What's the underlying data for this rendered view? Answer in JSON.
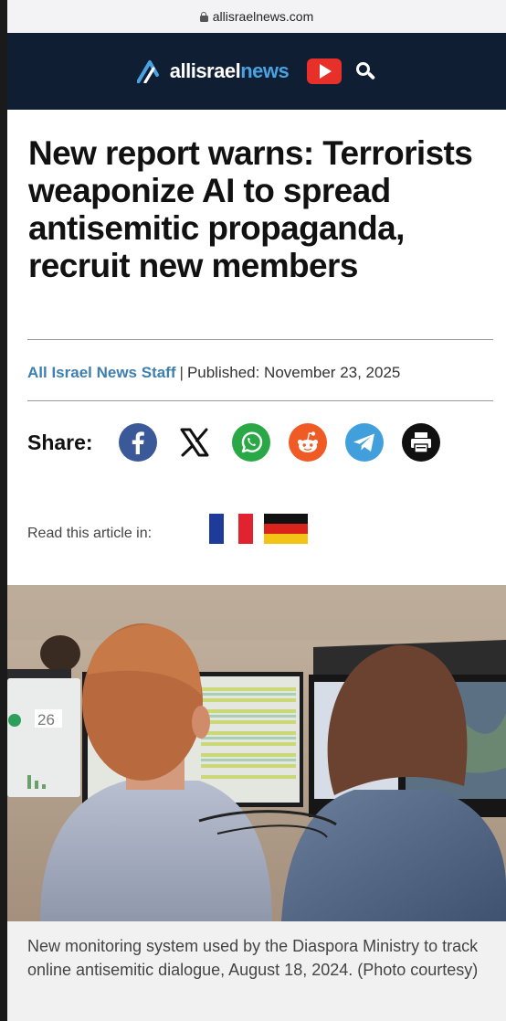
{
  "browser": {
    "url": "allisraelnews.com"
  },
  "header": {
    "logo_part1": "allisrael",
    "logo_part2": "news",
    "icons": {
      "youtube": "youtube-icon",
      "search": "search-icon"
    },
    "colors": {
      "bg": "#0f1e33",
      "accent": "#4aa3e0"
    }
  },
  "article": {
    "headline": "New report warns: Terrorists weaponize AI to spread antisemitic propaganda, recruit new members",
    "author": "All Israel News Staff",
    "separator": "|",
    "published": "Published: November 23, 2025"
  },
  "share": {
    "label": "Share:",
    "buttons": [
      {
        "name": "facebook-icon",
        "color": "#3b5998"
      },
      {
        "name": "x-icon",
        "color": "#ffffff"
      },
      {
        "name": "whatsapp-icon",
        "color": "#2aa845"
      },
      {
        "name": "reddit-icon",
        "color": "#f05a24"
      },
      {
        "name": "telegram-icon",
        "color": "#41a0db"
      },
      {
        "name": "print-icon",
        "color": "#111111"
      }
    ]
  },
  "languages": {
    "label": "Read this article in:",
    "flags": [
      "france-flag-icon",
      "germany-flag-icon"
    ]
  },
  "photo": {
    "screen_number": "26",
    "caption": "New monitoring system used by the Diaspora Ministry to track online antisemitic dialogue, August 18, 2024. (Photo courtesy)"
  }
}
